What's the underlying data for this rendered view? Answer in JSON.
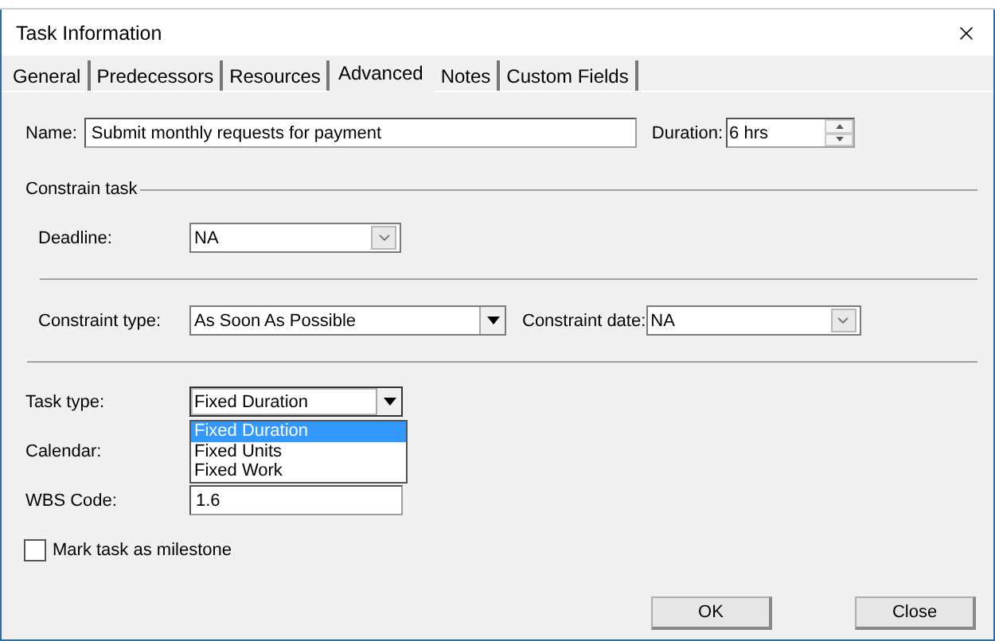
{
  "window": {
    "title": "Task Information"
  },
  "tabs": [
    {
      "label": "General",
      "selected": false
    },
    {
      "label": "Predecessors",
      "selected": false
    },
    {
      "label": "Resources",
      "selected": false
    },
    {
      "label": "Advanced",
      "selected": true
    },
    {
      "label": "Notes",
      "selected": false
    },
    {
      "label": "Custom Fields",
      "selected": false
    }
  ],
  "name": {
    "label": "Name:",
    "value": "Submit monthly requests for payment"
  },
  "duration": {
    "label": "Duration:",
    "value": "6 hrs"
  },
  "constrain_task": {
    "title": "Constrain task",
    "deadline": {
      "label": "Deadline:",
      "value": "NA",
      "kind": "date"
    },
    "constraint_type": {
      "label": "Constraint type:",
      "value": "As Soon As Possible",
      "kind": "list"
    },
    "constraint_date": {
      "label": "Constraint date:",
      "value": "NA",
      "kind": "date"
    }
  },
  "task_type": {
    "label": "Task type:",
    "value": "Fixed Duration",
    "kind": "list",
    "expanded": true,
    "options": [
      {
        "label": "Fixed Duration",
        "selected": true
      },
      {
        "label": "Fixed Units",
        "selected": false
      },
      {
        "label": "Fixed Work",
        "selected": false
      }
    ]
  },
  "calendar": {
    "label": "Calendar:"
  },
  "wbs_code": {
    "label": "WBS Code:",
    "value": "1.6"
  },
  "milestone": {
    "label": "Mark task as milestone",
    "checked": false
  },
  "buttons": [
    {
      "label": "OK"
    },
    {
      "label": "Close"
    }
  ]
}
